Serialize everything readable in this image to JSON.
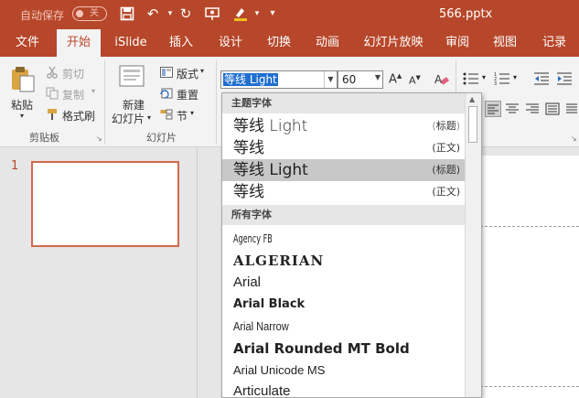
{
  "titlebar": {
    "autosave_label": "自动保存",
    "autosave_state": "关",
    "filename": "566.pptx",
    "icons": [
      "save-icon",
      "undo-icon",
      "redo-icon",
      "slideshow-icon",
      "highlighter-icon",
      "customize-qat-icon"
    ]
  },
  "tabs": [
    {
      "label": "文件",
      "active": false
    },
    {
      "label": "开始",
      "active": true
    },
    {
      "label": "iSlide",
      "active": false
    },
    {
      "label": "插入",
      "active": false
    },
    {
      "label": "设计",
      "active": false
    },
    {
      "label": "切换",
      "active": false
    },
    {
      "label": "动画",
      "active": false
    },
    {
      "label": "幻灯片放映",
      "active": false
    },
    {
      "label": "审阅",
      "active": false
    },
    {
      "label": "视图",
      "active": false
    },
    {
      "label": "记录",
      "active": false
    }
  ],
  "clipboard": {
    "paste": "粘贴",
    "cut": "剪切",
    "copy": "复制",
    "format_painter": "格式刷",
    "group_label": "剪贴板"
  },
  "slides_group": {
    "new_slide_1": "新建",
    "new_slide_2": "幻灯片",
    "layout": "版式",
    "reset": "重置",
    "section": "节",
    "group_label": "幻灯片"
  },
  "font": {
    "current_font": "等线 Light",
    "current_size": "60"
  },
  "dropdown": {
    "theme_header": "主题字体",
    "theme_fonts": [
      {
        "name": "等线 Light",
        "tag": "(标题)",
        "highlight": false
      },
      {
        "name": "等线",
        "tag": "(正文)",
        "highlight": false
      },
      {
        "name": "等线 Light",
        "tag": "(标题)",
        "highlight": true
      },
      {
        "name": "等线",
        "tag": "(正文)",
        "highlight": false
      }
    ],
    "all_header": "所有字体",
    "all_fonts": [
      "Agency FB",
      "ALGERIAN",
      "Arial",
      "Arial Black",
      "Arial Narrow",
      "Arial Rounded MT Bold",
      "Arial Unicode MS",
      "Articulate"
    ]
  },
  "thumbnails": {
    "slide_number": "1"
  },
  "colors": {
    "accent": "#b7472a",
    "highlight": "#1f6fd0"
  }
}
